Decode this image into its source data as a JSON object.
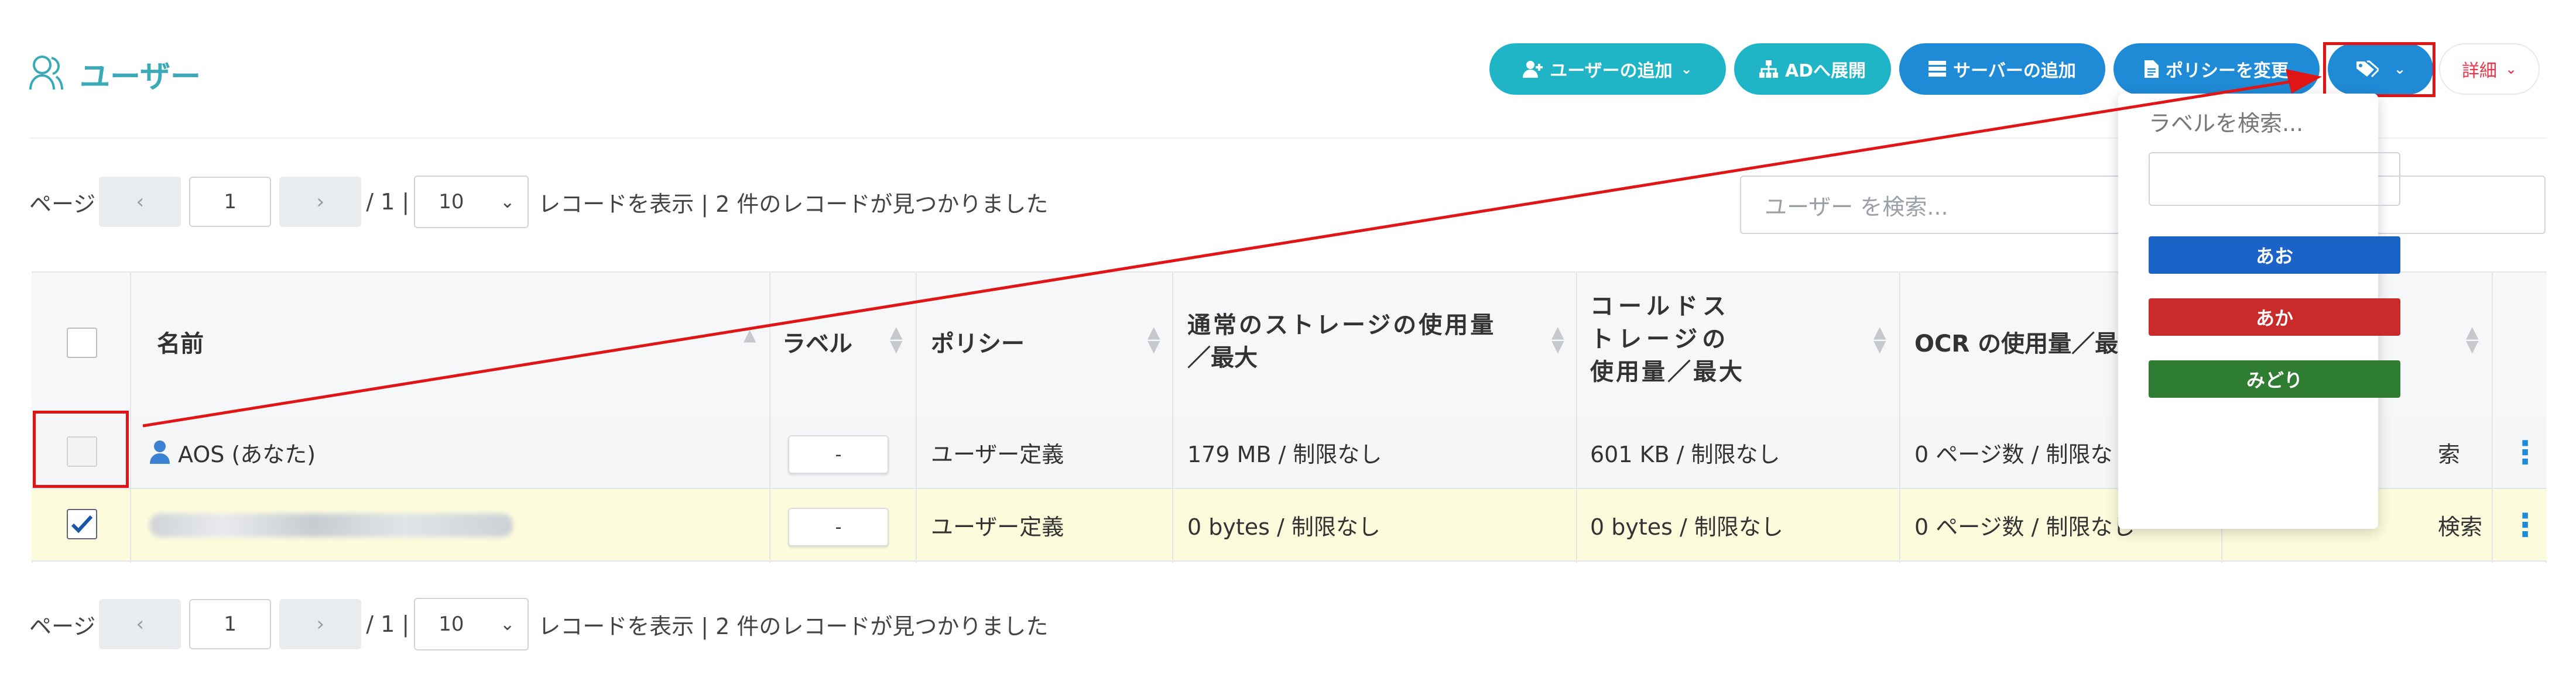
{
  "header": {
    "title": "ユーザー",
    "buttons": {
      "add_user": "ユーザーの追加",
      "ad_deploy": "ADへ展開",
      "add_server": "サーバーの追加",
      "change_policy": "ポリシーを変更",
      "details": "詳細"
    }
  },
  "pager": {
    "label": "ページ",
    "prev": "‹",
    "next": "›",
    "current_page": "1",
    "total": "/ 1 |",
    "per_page": "10",
    "records_text": "レコードを表示 | 2 件のレコードが見つかりました"
  },
  "search": {
    "placeholder": "ユーザー を検索..."
  },
  "table": {
    "headers": {
      "name": "名前",
      "label": "ラベル",
      "policy": "ポリシー",
      "storage_l1": "通常のストレージの使用量",
      "storage_l2": "／最大",
      "cold_l1": "コールドス",
      "cold_l2": "トレージの",
      "cold_l3": "使用量／最大",
      "ocr": "OCR の使用量／最"
    },
    "rows": [
      {
        "name": "AOS (あなた)",
        "label": "-",
        "policy": "ユーザー定義",
        "storage": "179 MB / 制限なし",
        "cold": "601 KB / 制限なし",
        "ocr": "0 ページ数 / 制限な",
        "extra": "索",
        "checked": false
      },
      {
        "name": "",
        "label": "-",
        "policy": "ユーザー定義",
        "storage": "0 bytes / 制限なし",
        "cold": "0 bytes / 制限なし",
        "ocr": "0 ページ数 / 制限なし",
        "extra": "検索",
        "checked": true
      }
    ]
  },
  "label_dropdown": {
    "title": "ラベルを検索...",
    "input_value": "",
    "labels": [
      {
        "text": "あお",
        "color": "#1b63c6"
      },
      {
        "text": "あか",
        "color": "#c92a2a"
      },
      {
        "text": "みどり",
        "color": "#2e7d32"
      }
    ]
  },
  "colors": {
    "accent_teal": "#1fb5c7",
    "accent_blue": "#1f8ad6",
    "annotation_red": "#e01515",
    "selected_row": "#fcfbdc"
  }
}
